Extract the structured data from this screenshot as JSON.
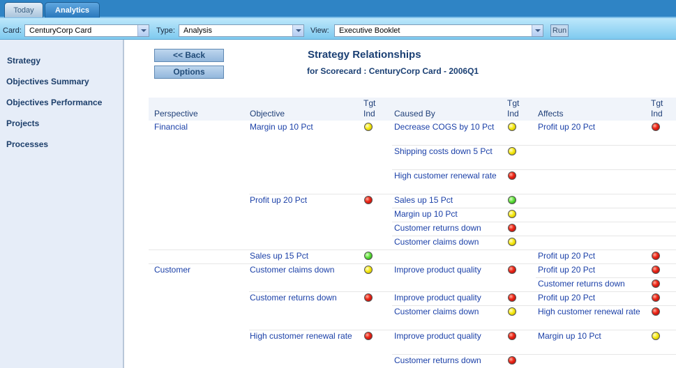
{
  "tabs": [
    {
      "label": "Today",
      "active": false
    },
    {
      "label": "Analytics",
      "active": true
    }
  ],
  "toolbar": {
    "card_label": "Card:",
    "card_value": "CenturyCorp Card",
    "type_label": "Type:",
    "type_value": "Analysis",
    "view_label": "View:",
    "view_value": "Executive Booklet",
    "run_label": "Run"
  },
  "sidebar": {
    "items": [
      {
        "label": "Strategy"
      },
      {
        "label": "Objectives Summary"
      },
      {
        "label": "Objectives Performance"
      },
      {
        "label": "Projects"
      },
      {
        "label": "Processes"
      }
    ]
  },
  "main": {
    "back_label": "<< Back",
    "options_label": "Options",
    "title": "Strategy Relationships",
    "subtitle": "for Scorecard : CenturyCorp Card - 2006Q1"
  },
  "table": {
    "headers": {
      "perspective": "Perspective",
      "objective": "Objective",
      "tgt1_line1": "Tgt",
      "tgt1_line2": "Ind",
      "caused_by": "Caused By",
      "tgt2_line1": "Tgt",
      "tgt2_line2": "Ind",
      "affects": "Affects",
      "tgt3_line1": "Tgt",
      "tgt3_line2": "Ind"
    },
    "rows": [
      {
        "perspective": "Financial",
        "objective": "Margin up 10 Pct",
        "obj_ind": "yellow",
        "caused_by": "Decrease COGS by 10 Pct",
        "cause_ind": "yellow",
        "affects": "Profit up 20 Pct",
        "aff_ind": "red"
      },
      {
        "perspective": "",
        "objective": "",
        "obj_ind": "",
        "caused_by": "Shipping costs down 5 Pct",
        "cause_ind": "yellow",
        "affects": "",
        "aff_ind": ""
      },
      {
        "perspective": "",
        "objective": "",
        "obj_ind": "",
        "caused_by": "High customer renewal rate",
        "cause_ind": "red",
        "affects": "",
        "aff_ind": ""
      },
      {
        "perspective": "",
        "objective": "Profit up 20 Pct",
        "obj_ind": "red",
        "caused_by": "Sales up 15 Pct",
        "cause_ind": "green",
        "affects": "",
        "aff_ind": ""
      },
      {
        "perspective": "",
        "objective": "",
        "obj_ind": "",
        "caused_by": "Margin up 10 Pct",
        "cause_ind": "yellow",
        "affects": "",
        "aff_ind": ""
      },
      {
        "perspective": "",
        "objective": "",
        "obj_ind": "",
        "caused_by": "Customer returns down",
        "cause_ind": "red",
        "affects": "",
        "aff_ind": ""
      },
      {
        "perspective": "",
        "objective": "",
        "obj_ind": "",
        "caused_by": "Customer claims down",
        "cause_ind": "yellow",
        "affects": "",
        "aff_ind": ""
      },
      {
        "perspective": "",
        "objective": "Sales up 15 Pct",
        "obj_ind": "green",
        "caused_by": "",
        "cause_ind": "",
        "affects": "Profit up 20 Pct",
        "aff_ind": "red"
      },
      {
        "perspective": "Customer",
        "objective": "Customer claims down",
        "obj_ind": "yellow",
        "caused_by": "Improve product quality",
        "cause_ind": "red",
        "affects": "Profit up 20 Pct",
        "aff_ind": "red"
      },
      {
        "perspective": "",
        "objective": "",
        "obj_ind": "",
        "caused_by": "",
        "cause_ind": "",
        "affects": "Customer returns down",
        "aff_ind": "red"
      },
      {
        "perspective": "",
        "objective": "Customer returns down",
        "obj_ind": "red",
        "caused_by": "Improve product quality",
        "cause_ind": "red",
        "affects": "Profit up 20 Pct",
        "aff_ind": "red"
      },
      {
        "perspective": "",
        "objective": "",
        "obj_ind": "",
        "caused_by": "Customer claims down",
        "cause_ind": "yellow",
        "affects": "High customer renewal rate",
        "aff_ind": "red"
      },
      {
        "perspective": "",
        "objective": "High customer renewal rate",
        "obj_ind": "red",
        "caused_by": "Improve product quality",
        "cause_ind": "red",
        "affects": "Margin up 10 Pct",
        "aff_ind": "yellow"
      },
      {
        "perspective": "",
        "objective": "",
        "obj_ind": "",
        "caused_by": "Customer returns down",
        "cause_ind": "red",
        "affects": "",
        "aff_ind": ""
      }
    ]
  }
}
